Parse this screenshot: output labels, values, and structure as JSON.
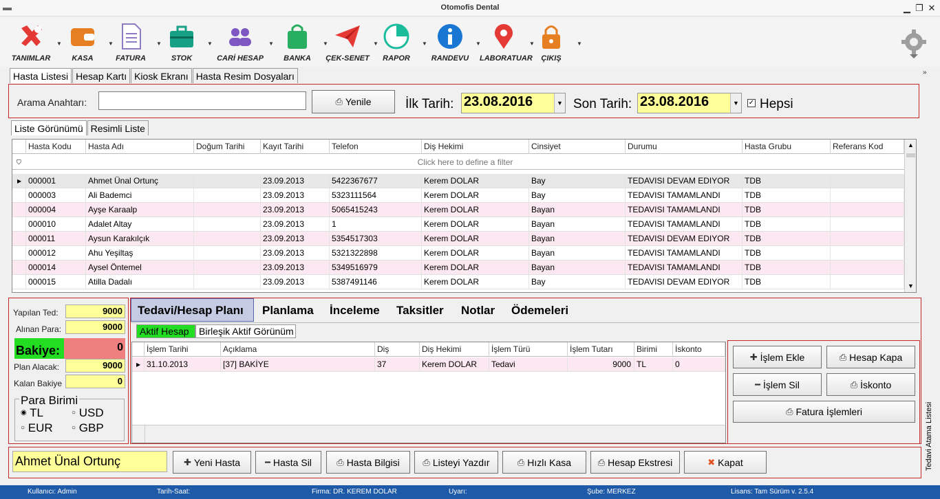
{
  "window": {
    "title": "Otomofis Dental"
  },
  "toolbar": {
    "items": [
      {
        "label": "TANIMLAR",
        "icon": "tools-icon",
        "color": "#e53935"
      },
      {
        "label": "KASA",
        "icon": "wallet-icon",
        "color": "#e67e22"
      },
      {
        "label": "FATURA",
        "icon": "document-icon",
        "color": "#8e7cc3"
      },
      {
        "label": "STOK",
        "icon": "briefcase-icon",
        "color": "#16a085"
      },
      {
        "label": "CARİ HESAP",
        "icon": "users-icon",
        "color": "#7e57c2"
      },
      {
        "label": "BANKA",
        "icon": "bag-icon",
        "color": "#27ae60"
      },
      {
        "label": "ÇEK-SENET",
        "icon": "paper-plane-icon",
        "color": "#e53935"
      },
      {
        "label": "RAPOR",
        "icon": "pie-chart-icon",
        "color": "#1abc9c"
      },
      {
        "label": "RANDEVU",
        "icon": "info-icon",
        "color": "#1976d2"
      },
      {
        "label": "LABORATUAR",
        "icon": "location-pin-icon",
        "color": "#e53935"
      },
      {
        "label": "ÇIKIŞ",
        "icon": "lock-icon",
        "color": "#e67e22"
      }
    ]
  },
  "main_tabs": [
    "Hasta Listesi",
    "Hesap Kartı",
    "Kiosk Ekranı",
    "Hasta Resim Dosyaları"
  ],
  "search": {
    "label": "Arama Anahtarı:",
    "value": "",
    "refresh": "Yenile",
    "start_label": "İlk Tarih:",
    "start_date": "23.08.2016",
    "end_label": "Son Tarih:",
    "end_date": "23.08.2016",
    "all_label": "Hepsi"
  },
  "view_tabs": [
    "Liste Görünümü",
    "Resimli Liste"
  ],
  "patients": {
    "columns": [
      "Hasta Kodu",
      "Hasta Adı",
      "Doğum Tarihi",
      "Kayıt Tarihi",
      "Telefon",
      "Diş Hekimi",
      "Cinsiyet",
      "Durumu",
      "Hasta Grubu",
      "Referans Kod"
    ],
    "filter_hint": "Click here to define a filter",
    "rows": [
      [
        "000001",
        "Ahmet Ünal Ortunç",
        "",
        "23.09.2013",
        "5422367677",
        "Kerem DOLAR",
        "Bay",
        "TEDAVISI DEVAM EDIYOR",
        "TDB",
        ""
      ],
      [
        "000003",
        "Ali Bademci",
        "",
        "23.09.2013",
        "5323111564",
        "Kerem DOLAR",
        "Bay",
        "TEDAVISI TAMAMLANDI",
        "TDB",
        ""
      ],
      [
        "000004",
        "Ayşe Karaalp",
        "",
        "23.09.2013",
        "5065415243",
        "Kerem DOLAR",
        "Bayan",
        "TEDAVISI TAMAMLANDI",
        "TDB",
        ""
      ],
      [
        "000010",
        "Adalet Altay",
        "",
        "23.09.2013",
        "1",
        "Kerem DOLAR",
        "Bayan",
        "TEDAVISI TAMAMLANDI",
        "TDB",
        ""
      ],
      [
        "000011",
        "Aysun Karakılçık",
        "",
        "23.09.2013",
        "5354517303",
        "Kerem DOLAR",
        "Bayan",
        "TEDAVISI DEVAM EDIYOR",
        "TDB",
        ""
      ],
      [
        "000012",
        "Ahu Yeşiltaş",
        "",
        "23.09.2013",
        "5321322898",
        "Kerem DOLAR",
        "Bayan",
        "TEDAVISI TAMAMLANDI",
        "TDB",
        ""
      ],
      [
        "000014",
        "Aysel Öntemel",
        "",
        "23.09.2013",
        "5349516979",
        "Kerem DOLAR",
        "Bayan",
        "TEDAVISI TAMAMLANDI",
        "TDB",
        ""
      ],
      [
        "000015",
        "Atilla Dadalı",
        "",
        "23.09.2013",
        "5387491146",
        "Kerem DOLAR",
        "Bay",
        "TEDAVISI DEVAM EDIYOR",
        "TDB",
        ""
      ]
    ]
  },
  "summary": {
    "done_label": "Yapılan Ted:",
    "done": "9000",
    "received_label": "Alınan Para:",
    "received": "9000",
    "balance_label": "Bakiye:",
    "balance": "0",
    "plan_label": "Plan Alacak:",
    "plan": "9000",
    "remaining_label": "Kalan Bakiye",
    "remaining": "0",
    "currency_title": "Para Birimi",
    "currencies": [
      "TL",
      "USD",
      "EUR",
      "GBP"
    ]
  },
  "content_tabs": [
    "Tedavi/Hesap Planı",
    "Planlama",
    "İnceleme",
    "Taksitler",
    "Notlar",
    "Ödemeleri"
  ],
  "sub_tabs": [
    "Aktif Hesap",
    "Birleşik Aktif Görünüm"
  ],
  "treatments": {
    "columns": [
      "İşlem Tarihi",
      "Açıklama",
      "Diş",
      "Diş Hekimi",
      "İşlem Türü",
      "İşlem Tutarı",
      "Birimi",
      "İskonto"
    ],
    "rows": [
      [
        "31.10.2013",
        "[37] BAKİYE",
        "37",
        "Kerem DOLAR",
        "Tedavi",
        "9000",
        "TL",
        "0"
      ]
    ]
  },
  "actions": {
    "add": "İşlem Ekle",
    "close_account": "Hesap Kapa",
    "delete": "İşlem Sil",
    "discount": "İskonto",
    "invoice": "Fatura İşlemleri"
  },
  "side_label": "Tedavi Atama Listesi",
  "bottom": {
    "patient": "Ahmet Ünal Ortunç",
    "new": "Yeni Hasta",
    "delete": "Hasta Sil",
    "info": "Hasta Bilgisi",
    "print": "Listeyi Yazdır",
    "cash": "Hızlı Kasa",
    "statement": "Hesap Ekstresi",
    "close": "Kapat"
  },
  "status": {
    "user": "Kullanıcı: Admin",
    "datetime": "Tarih-Saat:",
    "firm": "Firma: DR. KEREM DOLAR",
    "warn": "Uyarı:",
    "branch": "Şube: MERKEZ",
    "license": "Lisans: Tam Sürüm v. 2.5.4"
  }
}
